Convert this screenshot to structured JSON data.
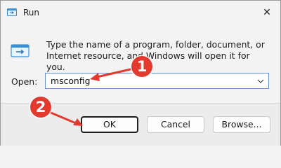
{
  "window": {
    "title": "Run",
    "close_symbol": "✕"
  },
  "dialog": {
    "description": "Type the name of a program, folder, document, or Internet resource, and Windows will open it for you.",
    "open_label": "Open:",
    "open_value": "msconfig"
  },
  "buttons": {
    "ok": "OK",
    "cancel": "Cancel",
    "browse": "Browse..."
  },
  "annotations": {
    "badge1": "1",
    "badge2": "2"
  },
  "colors": {
    "annotation": "#e23b2e"
  },
  "icons": {
    "title": "run-icon",
    "dialog": "run-icon",
    "dropdown": "chevron-down-icon",
    "close": "close-icon"
  }
}
